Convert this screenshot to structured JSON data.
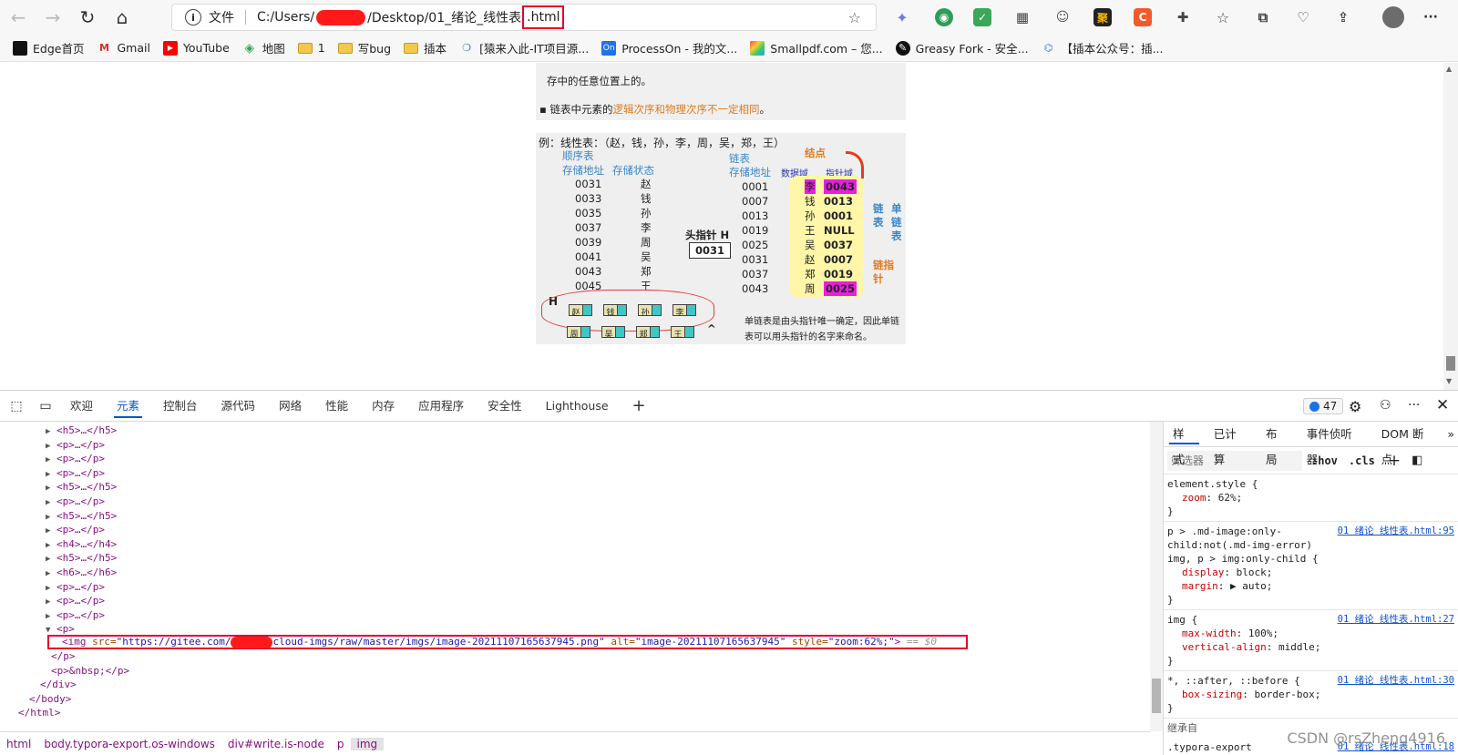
{
  "browser": {
    "nav": {
      "back": "←",
      "forward": "→",
      "reload": "↻",
      "home": "⌂"
    },
    "address": {
      "file_label": "文件",
      "url_prefix": "C:/Users/",
      "url_middle": "/Desktop/01_绪论_线性表",
      "url_suffix": ".html"
    },
    "extensions": [
      "feather-icon",
      "globe-icon",
      "shield-icon",
      "qr-icon",
      "robot-icon",
      "ju-icon",
      "c-icon",
      "puzzle-icon",
      "favorites-icon",
      "collections-icon",
      "performance-icon",
      "share-icon",
      "avatar",
      "more-icon"
    ],
    "ext_labels": {
      "ju": "聚",
      "c": "C",
      "more": "···"
    }
  },
  "bookmarks": [
    {
      "icon": "edge-icon",
      "label": "Edge首页"
    },
    {
      "icon": "gmail-icon",
      "label": "Gmail"
    },
    {
      "icon": "youtube-icon",
      "label": "YouTube"
    },
    {
      "icon": "maps-icon",
      "label": "地图"
    },
    {
      "icon": "folder-icon",
      "label": "1"
    },
    {
      "icon": "folder-icon",
      "label": "写bug"
    },
    {
      "icon": "folder-icon",
      "label": "插本"
    },
    {
      "icon": "site-icon",
      "label": "[猿来入此-IT项目源..."
    },
    {
      "icon": "processon-icon",
      "label": "ProcessOn - 我的文..."
    },
    {
      "icon": "smallpdf-icon",
      "label": "Smallpdf.com – 您..."
    },
    {
      "icon": "greasyfork-icon",
      "label": "Greasy Fork - 安全..."
    },
    {
      "icon": "site2-icon",
      "label": "【插本公众号：插..."
    }
  ],
  "page_image": {
    "top_line1": "存中的任意位置上的。",
    "top_line2_prefix": "▪ 链表中元素的",
    "top_line2_highlight": "逻辑次序和物理次序不一定相同",
    "top_line2_suffix": "。",
    "example": "例：线性表：（赵，钱，孙，李，周，吴，郑，王）",
    "seq_title": "顺序表",
    "seq_col1": "存储地址",
    "seq_col2": "存储状态",
    "seq_addrs": [
      "0031",
      "0033",
      "0035",
      "0037",
      "0039",
      "0041",
      "0043",
      "0045"
    ],
    "seq_vals": [
      "赵",
      "钱",
      "孙",
      "李",
      "周",
      "吴",
      "郑",
      "王"
    ],
    "head_ptr_label": "头指针 H",
    "head_ptr_val": "0031",
    "link_title": "链表",
    "link_col1": "存储地址",
    "node_label": "结点",
    "data_field": "数据域",
    "ptr_field": "指针域",
    "link_addrs": [
      "0001",
      "0007",
      "0013",
      "0019",
      "0025",
      "0031",
      "0037",
      "0043"
    ],
    "link_data": [
      "李",
      "钱",
      "孙",
      "王",
      "吴",
      "赵",
      "郑",
      "周"
    ],
    "link_ptrs": [
      "0043",
      "0013",
      "0001",
      "NULL",
      "0037",
      "0007",
      "0019",
      "0025"
    ],
    "single_list": "单链表",
    "link_list": "链表",
    "link_ptr": "链指针",
    "note1": "单链表是由头指针唯一确定，因此单链",
    "note2": "表可以用头指针的名字来命名。",
    "h": "H",
    "chain_top": [
      "赵",
      "钱",
      "孙",
      "李"
    ],
    "chain_bottom": [
      "周",
      "吴",
      "郑",
      "王"
    ],
    "null_mark": "^"
  },
  "devtools": {
    "tabs": [
      "欢迎",
      "元素",
      "控制台",
      "源代码",
      "网络",
      "性能",
      "内存",
      "应用程序",
      "安全性",
      "Lighthouse"
    ],
    "active_tab": "元素",
    "add_tab": "+",
    "issues_count": "47",
    "dom_lines": [
      {
        "indent": 0,
        "tri": "▶",
        "text": "<h5>…</h5>"
      },
      {
        "indent": 0,
        "tri": "▶",
        "text": "<p>…</p>"
      },
      {
        "indent": 0,
        "tri": "▶",
        "text": "<p>…</p>"
      },
      {
        "indent": 0,
        "tri": "▶",
        "text": "<p>…</p>"
      },
      {
        "indent": 0,
        "tri": "▶",
        "text": "<h5>…</h5>"
      },
      {
        "indent": 0,
        "tri": "▶",
        "text": "<p>…</p>"
      },
      {
        "indent": 0,
        "tri": "▶",
        "text": "<h5>…</h5>"
      },
      {
        "indent": 0,
        "tri": "▶",
        "text": "<p>…</p>"
      },
      {
        "indent": 0,
        "tri": "▶",
        "text": "<h4>…</h4>"
      },
      {
        "indent": 0,
        "tri": "▶",
        "text": "<h5>…</h5>"
      },
      {
        "indent": 0,
        "tri": "▶",
        "text": "<h6>…</h6>"
      },
      {
        "indent": 0,
        "tri": "▶",
        "text": "<p>…</p>"
      },
      {
        "indent": 0,
        "tri": "▶",
        "text": "<p>…</p>"
      },
      {
        "indent": 0,
        "tri": "▶",
        "text": "<p>…</p>"
      },
      {
        "indent": 0,
        "tri": "▼",
        "text": "<p>"
      }
    ],
    "img_line": {
      "open": "<img ",
      "src_n": "src=",
      "src_v1": "\"https://gitee.com/",
      "src_v2": "cloud-imgs/raw/master/imgs/image-20211107165637945.png\"",
      "alt_n": " alt=",
      "alt_v": "\"image-20211107165637945\"",
      "style_n": " style=",
      "style_v": "\"zoom:62%;\"",
      "close": ">",
      "eq": " == $0"
    },
    "dom_after": [
      {
        "text": "</p>"
      },
      {
        "text": "<p>&nbsp;</p>"
      },
      {
        "text": "</div>"
      },
      {
        "text": "</body>"
      },
      {
        "text": "</html>"
      }
    ],
    "crumbs": [
      "html",
      "body.typora-export.os-windows",
      "div#write.is-node",
      "p",
      "img"
    ],
    "styles": {
      "tabs": [
        "样式",
        "已计算",
        "布局",
        "事件侦听器",
        "DOM 断点"
      ],
      "filter_placeholder": "筛选器",
      "hov": ":hov",
      "cls": ".cls",
      "rules": [
        {
          "selector": "element.style {",
          "src": "",
          "props": [
            [
              "zoom",
              "62%;"
            ]
          ]
        },
        {
          "selector": "p > .md-image:only-child:not(.md-img-error) img, p > img:only-child {",
          "src": "01 绪论 线性表.html:95",
          "props": [
            [
              "display",
              "block;"
            ],
            [
              "margin",
              "▶ auto;"
            ]
          ]
        },
        {
          "selector": "img {",
          "src": "01 绪论 线性表.html:27",
          "props": [
            [
              "max-width",
              "100%;"
            ],
            [
              "vertical-align",
              "middle;"
            ]
          ]
        },
        {
          "selector": "*, ::after, ::before {",
          "src": "01 绪论 线性表.html:30",
          "props": [
            [
              "box-sizing",
              "border-box;"
            ]
          ]
        }
      ],
      "inherited": "继承自",
      "inherited_from": ".typora-export",
      "inherited_src": "01 绪论 线性表.html:18"
    },
    "watermark": "CSDN @rsZheng4916"
  }
}
